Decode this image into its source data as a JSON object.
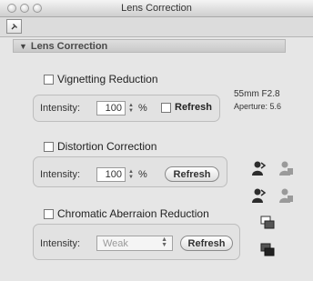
{
  "window": {
    "title": "Lens Correction"
  },
  "toolbar": {
    "pin_icon": "pin-icon"
  },
  "section": {
    "title": "Lens Correction"
  },
  "vignetting": {
    "label": "Vignetting Reduction",
    "intensity_label": "Intensity:",
    "value": "100",
    "unit": "%",
    "refresh_label": "Refresh"
  },
  "distortion": {
    "label": "Distortion Correction",
    "intensity_label": "Intensity:",
    "value": "100",
    "unit": "%",
    "refresh_label": "Refresh"
  },
  "chromatic": {
    "label": "Chromatic Aberraion Reduction",
    "intensity_label": "Intensity:",
    "selected": "Weak",
    "refresh_label": "Refresh"
  },
  "lens_info": {
    "focal": "55mm  F2.8",
    "aperture": "Aperture: 5.6"
  },
  "colors": {
    "window_bg": "#e6e6e6",
    "header_text": "#4a4a4a"
  }
}
